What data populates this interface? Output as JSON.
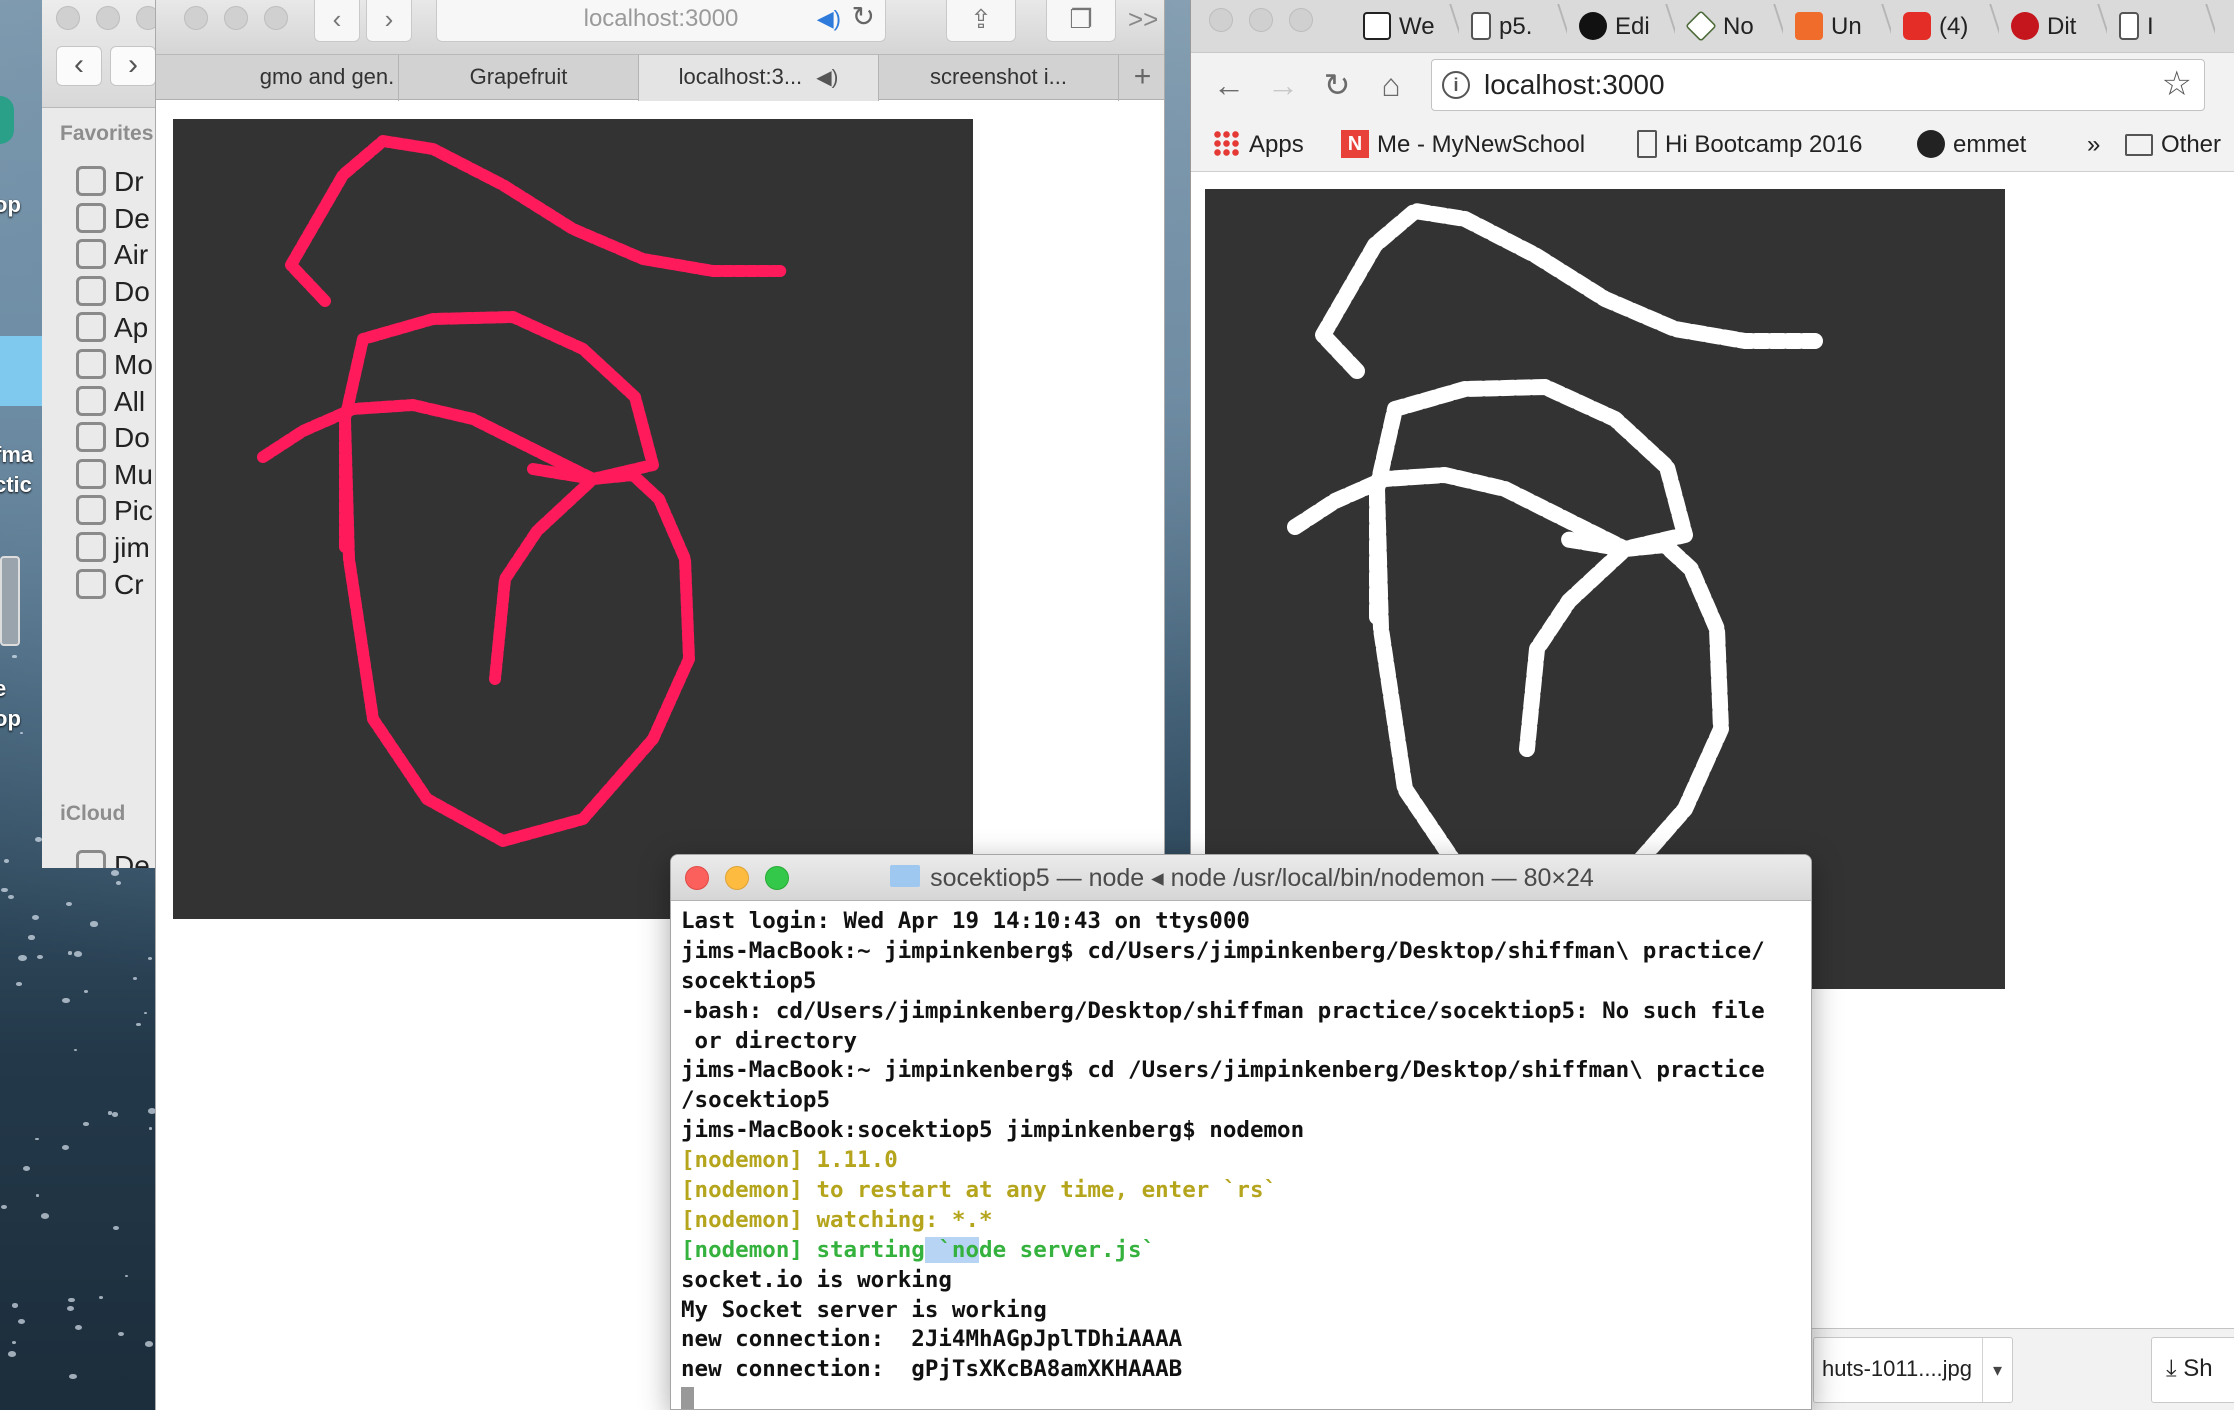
{
  "finder": {
    "section_favorites": "Favorites",
    "section_icloud": "iCloud",
    "items": [
      "Dr",
      "De",
      "Air",
      "Do",
      "Ap",
      "Mo",
      "All",
      "Do",
      "Mu",
      "Pic",
      "jim",
      "Cr"
    ],
    "icloud_items": [
      "De"
    ]
  },
  "desktop": {
    "text_lines": [
      "op",
      "fma",
      "ctic",
      "e",
      "op"
    ]
  },
  "safari": {
    "url": "localhost:3000",
    "tabs": [
      "gmo and gen.",
      "Grapefruit",
      "localhost:3...",
      "screenshot i..."
    ],
    "new_tab": "+",
    "overflow": ">>"
  },
  "chrome": {
    "tabs": [
      {
        "label": "We",
        "icon": "codepen-icon"
      },
      {
        "label": "p5.",
        "icon": "document-icon"
      },
      {
        "label": "Edi",
        "icon": "github-icon"
      },
      {
        "label": "No",
        "icon": "node-icon"
      },
      {
        "label": "Un",
        "icon": "unity-icon"
      },
      {
        "label": "(4)",
        "icon": "youtube-icon"
      },
      {
        "label": "Dit",
        "icon": "cpp-icon"
      },
      {
        "label": "I",
        "icon": "document-icon"
      }
    ],
    "url": "localhost:3000",
    "bookmarks": [
      "Apps",
      "Me - MyNewSchool",
      "Hi Bootcamp 2016",
      "emmet"
    ],
    "bookmarks_overflow": "»",
    "other_bookmarks": "Other",
    "download_name": "huts-1011....jpg",
    "download_show": "Sh"
  },
  "terminal": {
    "title": "socektiop5 — node ◂ node /usr/local/bin/nodemon — 80×24",
    "lines": [
      {
        "text": "Last login: Wed Apr 19 14:10:43 on ttys000",
        "style": "plain"
      },
      {
        "text": "jims-MacBook:~ jimpinkenberg$ cd/Users/jimpinkenberg/Desktop/shiffman\\ practice/",
        "style": "plain"
      },
      {
        "text": "socektiop5",
        "style": "plain"
      },
      {
        "text": "-bash: cd/Users/jimpinkenberg/Desktop/shiffman practice/socektiop5: No such file",
        "style": "plain"
      },
      {
        "text": " or directory",
        "style": "plain"
      },
      {
        "text": "jims-MacBook:~ jimpinkenberg$ cd /Users/jimpinkenberg/Desktop/shiffman\\ practice",
        "style": "plain"
      },
      {
        "text": "/socektiop5",
        "style": "plain"
      },
      {
        "text": "jims-MacBook:socektiop5 jimpinkenberg$ nodemon",
        "style": "plain"
      },
      {
        "text": "[nodemon] 1.11.0",
        "style": "yellow"
      },
      {
        "text": "[nodemon] to restart at any time, enter `rs`",
        "style": "yellow"
      },
      {
        "text": "[nodemon] watching: *.*",
        "style": "yellow"
      },
      {
        "text_before": "[nodemon] starting",
        "text_selected": " `no",
        "text_after": "de server.js`",
        "style": "green"
      },
      {
        "text": "socket.io is working",
        "style": "plain"
      },
      {
        "text": "My Socket server is working",
        "style": "plain"
      },
      {
        "text": "new connection:  2Ji4MhAGpJplTDhiAAAA",
        "style": "plain"
      },
      {
        "text": "new connection:  gPjTsXKcBA8amXKHAAAB",
        "style": "plain"
      }
    ]
  },
  "colors": {
    "left_stroke": "#ff1a5c",
    "right_stroke": "#ffffff",
    "canvas_bg": "#333333"
  }
}
